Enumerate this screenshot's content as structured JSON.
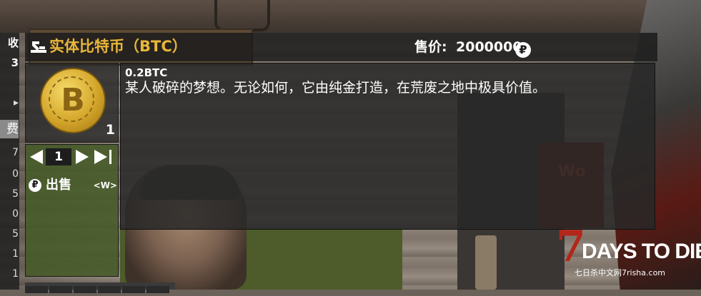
{
  "left_panel": {
    "top_label": "收 3",
    "selected_item": "费",
    "items": [
      "7",
      "0",
      "5",
      "0",
      "5",
      "1",
      "1"
    ]
  },
  "item_window": {
    "title": "实体比特币（BTC）",
    "price_label": "售价:",
    "price_value": "2000000",
    "currency_symbol": "₽",
    "item_count": "1",
    "quantity": "1",
    "sell_label": "出售",
    "sell_key": "<W>",
    "item_name": "0.2BTC",
    "description": "某人破碎的梦想。无论如何，它由纯金打造，在荒废之地中极具价值。",
    "coin_glyph": "B"
  },
  "background": {
    "sign_text": "Wo"
  },
  "logo": {
    "number": "7",
    "text": "DAYS TO DIE",
    "subtext": "七日杀中文网7risha.com"
  },
  "colors": {
    "title": "#e8b63a",
    "panel": "#1c1c1c",
    "action_panel": "#465a28",
    "logo_red": "#b3261a"
  },
  "icons": [
    "scrap-icon",
    "coin-icon",
    "bitcoin-icon",
    "arrow-left-icon",
    "arrow-right-icon",
    "arrow-max-icon"
  ]
}
